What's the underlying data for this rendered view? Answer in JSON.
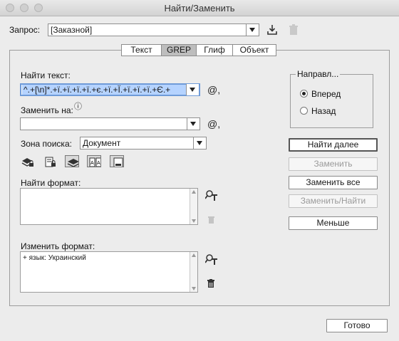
{
  "window": {
    "title": "Найти/Заменить"
  },
  "query": {
    "label": "Запрос:",
    "value": "[Заказной]"
  },
  "tabs": [
    {
      "label": "Текст",
      "active": false
    },
    {
      "label": "GREP",
      "active": true
    },
    {
      "label": "Глиф",
      "active": false
    },
    {
      "label": "Объект",
      "active": false
    }
  ],
  "find": {
    "label": "Найти текст:",
    "value": "^.+[\\n]*.+ï.+ï.+ï.+ï.+є.+ï.+Ï.+ï.+ï.+ï.+Є.+"
  },
  "replace": {
    "label": "Заменить на:",
    "value": ""
  },
  "search": {
    "label": "Зона поиска:",
    "value": "Документ"
  },
  "find_format": {
    "label": "Найти формат:",
    "value": ""
  },
  "change_format": {
    "label": "Изменить формат:",
    "value": "+ язык: Украинский"
  },
  "direction": {
    "label": "Направл...",
    "options": [
      {
        "label": "Вперед",
        "selected": true
      },
      {
        "label": "Назад",
        "selected": false
      }
    ]
  },
  "buttons": {
    "find_next": "Найти далее",
    "replace": "Заменить",
    "replace_all": "Заменить все",
    "replace_find": "Заменить/Найти",
    "fewer": "Меньше",
    "done": "Готово"
  },
  "special_char_glyph": "@,",
  "info_glyph": "ⓘ"
}
